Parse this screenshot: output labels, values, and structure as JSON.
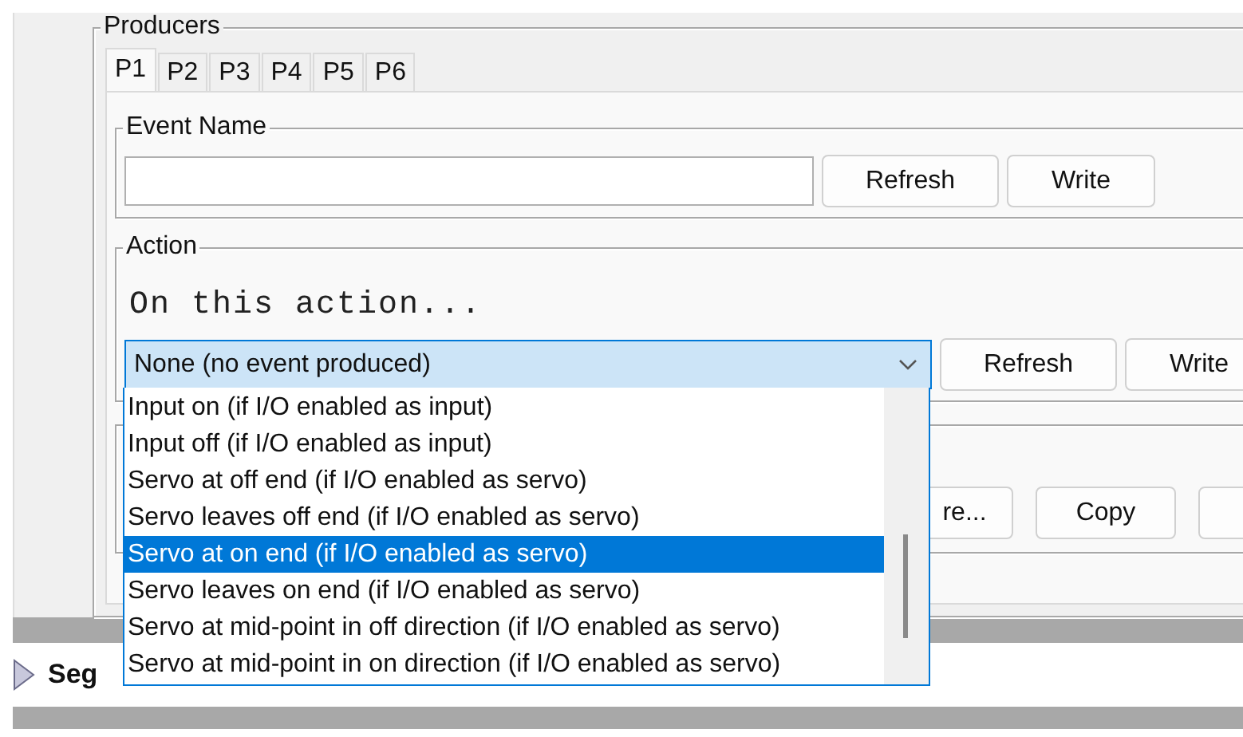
{
  "producers": {
    "title": "Producers",
    "tabs": [
      {
        "label": "P1",
        "selected": true
      },
      {
        "label": "P2",
        "selected": false
      },
      {
        "label": "P3",
        "selected": false
      },
      {
        "label": "P4",
        "selected": false
      },
      {
        "label": "P5",
        "selected": false
      },
      {
        "label": "P6",
        "selected": false
      }
    ],
    "event_name": {
      "title": "Event Name",
      "buttons": [
        "Refresh",
        "Write"
      ]
    },
    "action": {
      "title": "Action",
      "caption": "On this action...",
      "value": "None (no event produced)",
      "expanded": true,
      "buttons": [
        "Refresh",
        "Write"
      ],
      "options": [
        {
          "label": "Input on (if I/O enabled as input)",
          "selected": false
        },
        {
          "label": "Input off (if I/O enabled as input)",
          "selected": false
        },
        {
          "label": "Servo at off end (if I/O enabled as servo)",
          "selected": false
        },
        {
          "label": "Servo leaves off end (if I/O enabled as servo)",
          "selected": false
        },
        {
          "label": "Servo at on end (if I/O enabled as servo)",
          "selected": true
        },
        {
          "label": "Servo leaves on end (if I/O enabled as servo)",
          "selected": false
        },
        {
          "label": "Servo at mid-point in off direction (if I/O enabled as servo)",
          "selected": false
        },
        {
          "label": "Servo at mid-point in on direction (if I/O enabled as servo)",
          "selected": false
        }
      ]
    },
    "lower_buttons": [
      "re...",
      "Copy"
    ]
  },
  "segment": {
    "label": "Seg"
  }
}
